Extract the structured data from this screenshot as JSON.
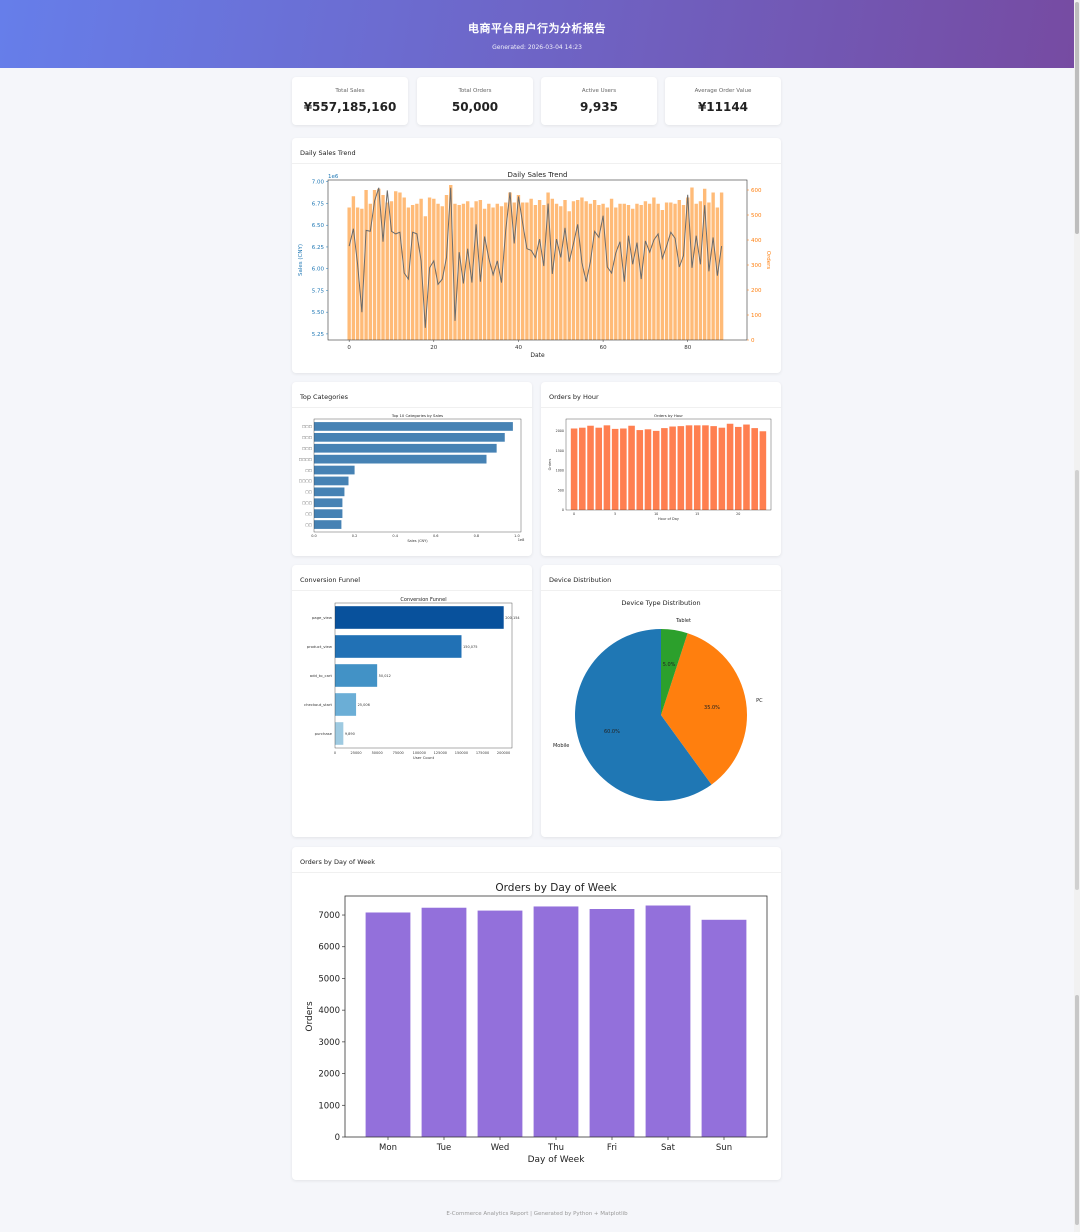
{
  "header": {
    "title": "电商平台用户行为分析报告",
    "generated": "Generated: 2026-03-04 14:23"
  },
  "kpis": [
    {
      "label": "Total Sales",
      "value": "¥557,185,160"
    },
    {
      "label": "Total Orders",
      "value": "50,000"
    },
    {
      "label": "Active Users",
      "value": "9,935"
    },
    {
      "label": "Average Order Value",
      "value": "¥11144"
    }
  ],
  "cards": {
    "daily": "Daily Sales Trend",
    "categories": "Top Categories",
    "hourly": "Orders by Hour",
    "funnel": "Conversion Funnel",
    "device": "Device Distribution",
    "weekday": "Orders by Day of Week"
  },
  "footer": "E-Commerce Analytics Report | Generated by Python + Matplotlib",
  "colors": {
    "header_start": "#667eea",
    "header_end": "#764ba2",
    "sales_line": "#1f77b4",
    "orders_bar": "#ffbb78",
    "category_bar": "#4682b4",
    "hour_bar": "#ff7f50",
    "weekday_bar": "#9370db"
  },
  "chart_data": [
    {
      "id": "daily",
      "type": "bar",
      "title": "Daily Sales Trend",
      "xlabel": "Date",
      "ylabel": "Sales (CNY)",
      "y2label": "Orders",
      "yscale_note": "1e6",
      "xlim": [
        -5,
        94
      ],
      "ylim": [
        5.18,
        7.02
      ],
      "y2lim": [
        0,
        640
      ],
      "xticks": [
        0,
        20,
        40,
        60,
        80
      ],
      "yticks": [
        5.25,
        5.5,
        5.75,
        6.0,
        6.25,
        6.5,
        6.75,
        7.0
      ],
      "y2ticks": [
        0,
        100,
        200,
        300,
        400,
        500,
        600
      ],
      "sales": [
        6.26,
        6.46,
        6.05,
        5.5,
        6.44,
        6.43,
        6.78,
        6.93,
        6.31,
        6.9,
        6.43,
        6.4,
        6.42,
        5.95,
        5.88,
        6.42,
        6.4,
        6.09,
        5.32,
        6.01,
        6.09,
        5.82,
        5.88,
        6.13,
        6.93,
        5.4,
        6.19,
        5.83,
        6.23,
        5.84,
        6.51,
        5.85,
        6.37,
        6.12,
        5.93,
        6.09,
        5.84,
        6.45,
        6.88,
        6.29,
        6.83,
        6.52,
        6.23,
        6.21,
        6.13,
        6.34,
        6.03,
        6.75,
        5.94,
        6.34,
        6.13,
        6.47,
        6.08,
        6.29,
        6.51,
        6.07,
        5.85,
        6.08,
        6.43,
        6.36,
        6.61,
        6.02,
        5.95,
        6.18,
        6.31,
        5.85,
        6.38,
        6.05,
        6.3,
        5.88,
        6.32,
        6.19,
        6.33,
        6.4,
        6.12,
        6.26,
        6.42,
        6.35,
        6.02,
        6.15,
        6.85,
        6.01,
        6.38,
        6.05,
        6.73,
        5.97,
        6.36,
        5.92,
        6.26
      ],
      "orders": [
        530,
        575,
        530,
        525,
        600,
        545,
        600,
        605,
        580,
        550,
        555,
        595,
        590,
        570,
        530,
        540,
        545,
        565,
        495,
        570,
        565,
        545,
        535,
        580,
        620,
        545,
        540,
        545,
        555,
        530,
        555,
        560,
        525,
        545,
        530,
        545,
        535,
        550,
        590,
        550,
        580,
        550,
        550,
        565,
        540,
        560,
        540,
        590,
        565,
        545,
        535,
        560,
        515,
        555,
        560,
        570,
        555,
        545,
        560,
        540,
        545,
        530,
        565,
        530,
        545,
        545,
        540,
        525,
        545,
        540,
        555,
        545,
        570,
        545,
        520,
        550,
        550,
        545,
        560,
        540,
        570,
        610,
        545,
        555,
        605,
        550,
        590,
        530,
        590
      ]
    },
    {
      "id": "categories",
      "type": "bar",
      "title": "Top 10 Categories by Sales",
      "xlabel": "Sales (CNY)",
      "xscale_note": "1e8",
      "xlim": [
        0,
        1.02
      ],
      "xticks": [
        0.0,
        0.2,
        0.4,
        0.6,
        0.8,
        1.0
      ],
      "categories": [
        "□□□",
        "□□□",
        "□□□",
        "□□□□",
        "□□",
        "□□□□",
        "□□",
        "□□□",
        "□□",
        "□□"
      ],
      "values": [
        0.98,
        0.94,
        0.9,
        0.85,
        0.2,
        0.17,
        0.15,
        0.14,
        0.14,
        0.135
      ]
    },
    {
      "id": "hourly",
      "type": "bar",
      "title": "Orders by Hour",
      "xlabel": "Hour of Day",
      "ylabel": "Orders",
      "ylim": [
        0,
        2300
      ],
      "yticks": [
        0,
        500,
        1000,
        1500,
        2000
      ],
      "xticks": [
        0,
        5,
        10,
        15,
        20
      ],
      "categories": [
        0,
        1,
        2,
        3,
        4,
        5,
        6,
        7,
        8,
        9,
        10,
        11,
        12,
        13,
        14,
        15,
        16,
        17,
        18,
        19,
        20,
        21,
        22,
        23
      ],
      "values": [
        2060,
        2080,
        2130,
        2080,
        2140,
        2050,
        2060,
        2130,
        2020,
        2040,
        2000,
        2070,
        2110,
        2120,
        2140,
        2140,
        2140,
        2120,
        2080,
        2180,
        2100,
        2160,
        2070,
        1990
      ]
    },
    {
      "id": "funnel",
      "type": "bar",
      "title": "Conversion Funnel",
      "xlabel": "User Count",
      "xlim": [
        0,
        210000
      ],
      "xticks": [
        0,
        25000,
        50000,
        75000,
        100000,
        125000,
        150000,
        175000,
        200000
      ],
      "categories": [
        "page_view",
        "product_view",
        "add_to_cart",
        "checkout_start",
        "purchase"
      ],
      "values": [
        200154,
        150075,
        50012,
        25006,
        9890
      ],
      "labels": [
        "200,154",
        "150,075",
        "50,012",
        "25,006",
        "9,890"
      ]
    },
    {
      "id": "device",
      "type": "pie",
      "title": "Device Type Distribution",
      "categories": [
        "Mobile",
        "PC",
        "Tablet"
      ],
      "values": [
        60.0,
        35.0,
        5.0
      ],
      "labels": [
        "60.0%",
        "35.0%",
        "5.0%"
      ],
      "colors": [
        "#1f77b4",
        "#ff7f0e",
        "#2ca02c"
      ]
    },
    {
      "id": "weekday",
      "type": "bar",
      "title": "Orders by Day of Week",
      "xlabel": "Day of Week",
      "ylabel": "Orders",
      "ylim": [
        0,
        7600
      ],
      "yticks": [
        0,
        1000,
        2000,
        3000,
        4000,
        5000,
        6000,
        7000
      ],
      "categories": [
        "Mon",
        "Tue",
        "Wed",
        "Thu",
        "Fri",
        "Sat",
        "Sun"
      ],
      "values": [
        7080,
        7230,
        7140,
        7270,
        7190,
        7300,
        6850
      ]
    }
  ]
}
